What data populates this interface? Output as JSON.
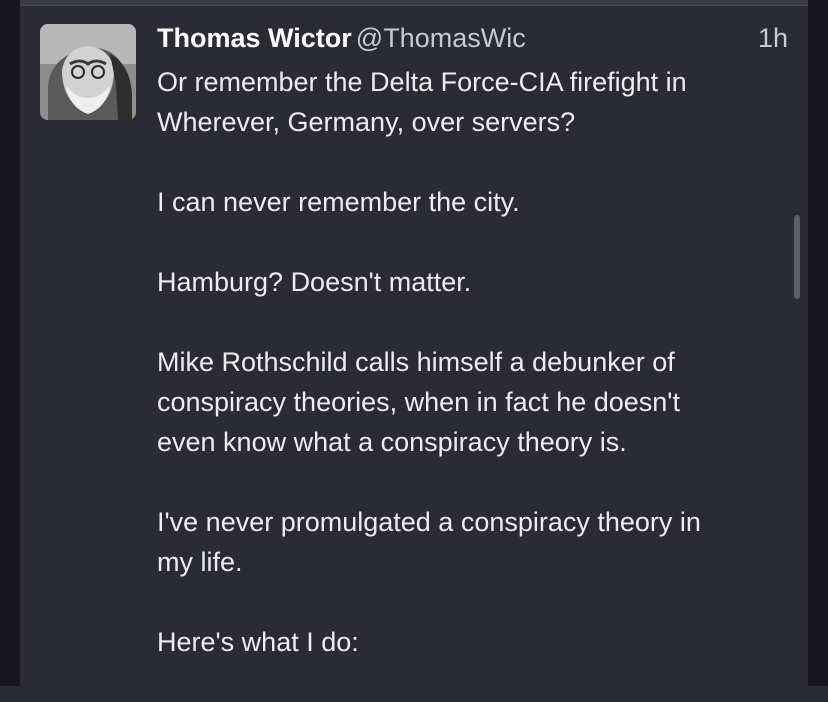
{
  "post": {
    "display_name": "Thomas Wictor",
    "handle": "@ThomasWic",
    "time": "1h",
    "paragraphs": [
      "Or remember the Delta Force-CIA firefight in\nWherever, Germany, over servers?",
      "I can never remember the city.",
      "Hamburg? Doesn't matter.",
      "Mike Rothschild calls himself a debunker of\nconspiracy theories, when in fact he doesn't\neven know what a conspiracy theory is.",
      "I've never promulgated a conspiracy theory in\nmy life.",
      "Here's what I do:"
    ]
  },
  "icons": {
    "avatar": "user-avatar-photo"
  }
}
